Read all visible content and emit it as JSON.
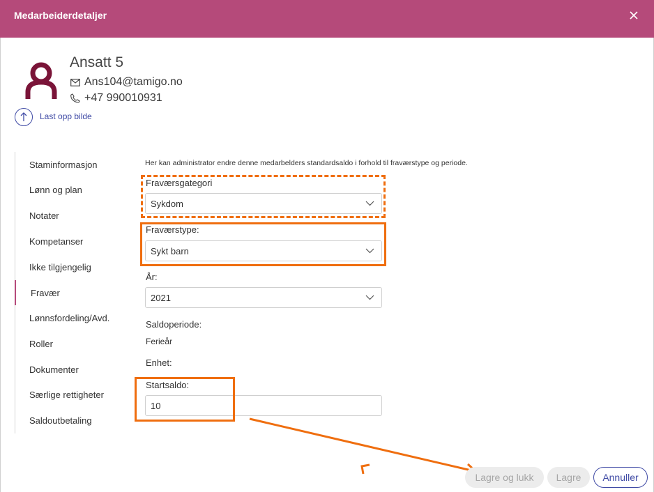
{
  "dialog": {
    "title": "Medarbeiderdetaljer",
    "close_icon": "close-icon"
  },
  "employee": {
    "name": "Ansatt 5",
    "email": "Ans104@tamigo.no",
    "phone": "+47 990010931",
    "upload_label": "Last opp bilde",
    "avatar_color": "#7a1438"
  },
  "sidebar": {
    "items": [
      {
        "label": "Staminformasjon"
      },
      {
        "label": "Lønn og plan"
      },
      {
        "label": "Notater"
      },
      {
        "label": "Kompetanser"
      },
      {
        "label": "Ikke tilgjengelig"
      },
      {
        "label": "Fravær",
        "active": true
      },
      {
        "label": "Lønnsfordeling/Avd."
      },
      {
        "label": "Roller"
      },
      {
        "label": "Dokumenter"
      },
      {
        "label": "Særlige rettigheter"
      },
      {
        "label": "Saldoutbetaling"
      }
    ]
  },
  "form": {
    "description": "Her kan administrator endre denne medarbelders standardsaldo i forhold til fraværstype og periode.",
    "category": {
      "label": "Fraværsgategori",
      "value": "Sykdom"
    },
    "type": {
      "label": "Fraværstype:",
      "value": "Sykt barn"
    },
    "year": {
      "label": "År:",
      "value": "2021"
    },
    "period": {
      "label": "Saldoperiode:",
      "value": "Ferieår"
    },
    "unit": {
      "label": "Enhet:"
    },
    "start_balance": {
      "label": "Startsaldo:",
      "value": "10"
    }
  },
  "footer": {
    "save_close_label": "Lagre og lukk",
    "save_label": "Lagre",
    "cancel_label": "Annuller"
  },
  "colors": {
    "header": "#b54a7a",
    "accent": "#3f4aa5",
    "annotation": "#ef6e0f"
  }
}
